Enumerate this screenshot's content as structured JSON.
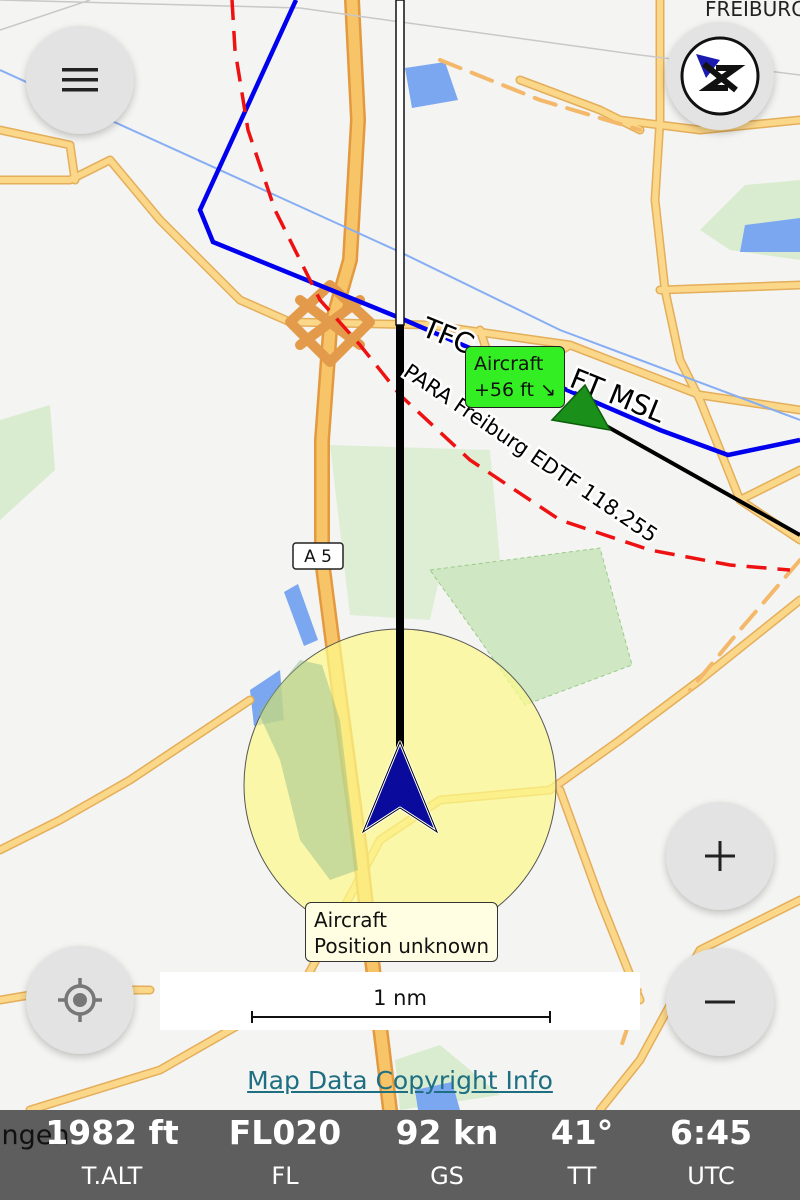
{
  "map": {
    "place_label": "FREIBURG",
    "road_label": "A 5",
    "airspace_label": "PARA Freiburg EDTF 118.255",
    "route_label": "TFC",
    "altitude_label": "FT MSL",
    "copyright_link": "Map Data Copyright Info"
  },
  "scale_bar": {
    "label": "1 nm"
  },
  "traffic": {
    "line1": "Aircraft",
    "line2": "+56 ft ↘"
  },
  "own_ship": {
    "line1": "Aircraft",
    "line2": "Position unknown"
  },
  "controls": {
    "menu_icon": "hamburger-menu-icon",
    "compass_icon": "compass-north-icon",
    "locate_icon": "crosshair-location-icon",
    "zoom_in_symbol": "+",
    "zoom_out_symbol": "−"
  },
  "status_bar": {
    "overlap_text": "ingen",
    "items": [
      {
        "value": "1982 ft",
        "label": "T.ALT"
      },
      {
        "value": "FL020",
        "label": "FL"
      },
      {
        "value": "92 kn",
        "label": "GS"
      },
      {
        "value": "41°",
        "label": "TT"
      },
      {
        "value": "6:45",
        "label": "UTC"
      }
    ]
  },
  "colors": {
    "map_background": "#f4f4f2",
    "road": "#f7c66a",
    "motorway": "#f5b74e",
    "airspace_blue": "#0000ee",
    "airspace_red_dashed": "#ee1111",
    "forest": "#cfe7c2",
    "water": "#7aa7f0",
    "own_ship_arrow": "#0a0a9c",
    "traffic_marker": "#1a8f1a",
    "traffic_label": "#33ee22",
    "position_uncertainty": "#fcf98a",
    "status_bar": "#5e5e5e"
  }
}
